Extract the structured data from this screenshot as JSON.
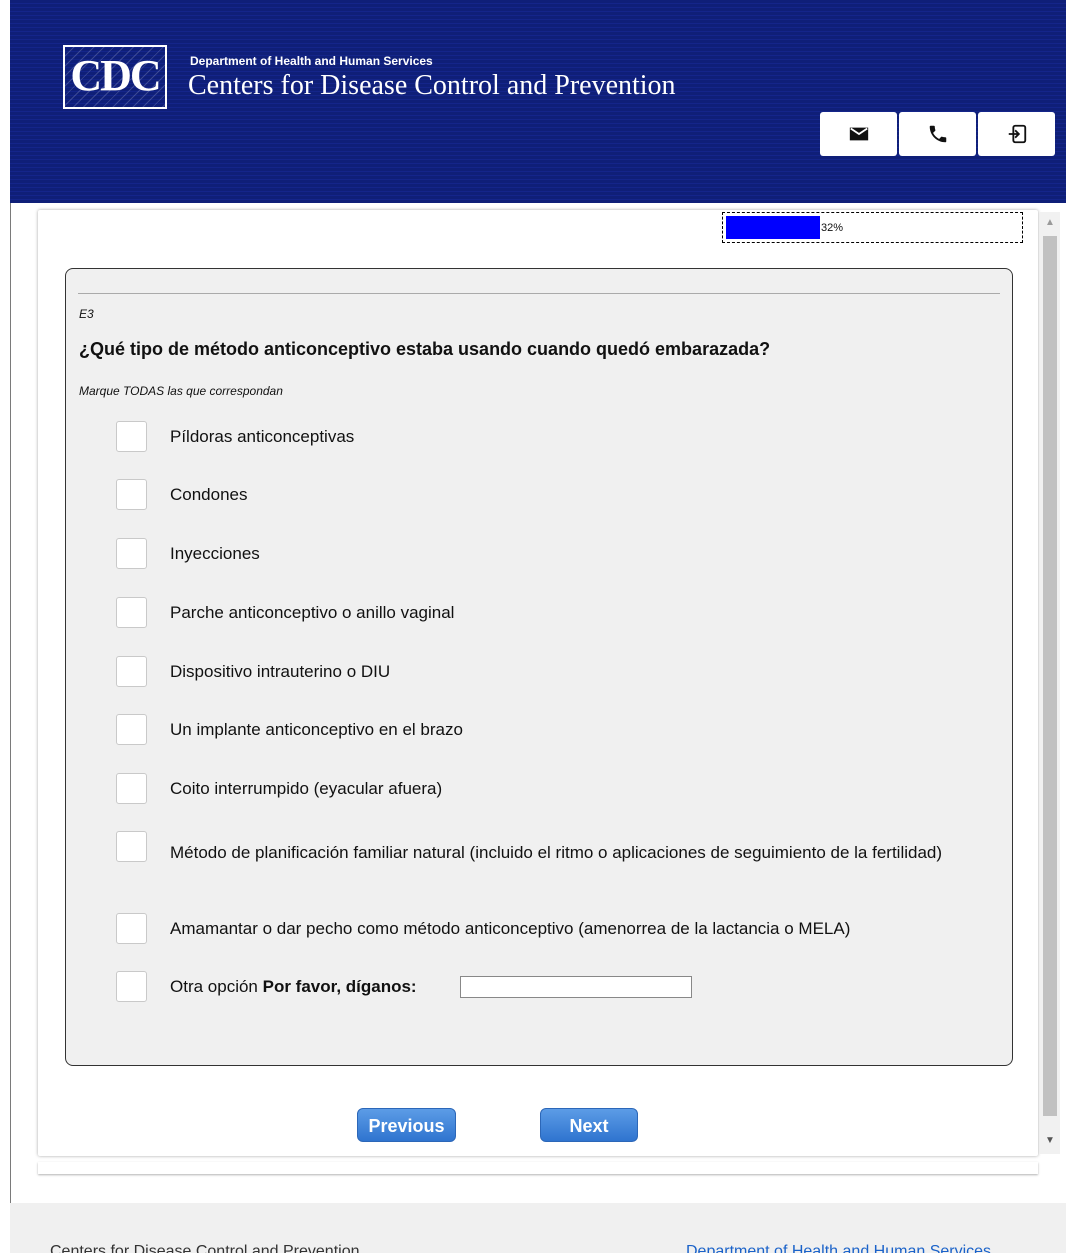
{
  "header": {
    "logo_text": "CDC",
    "department": "Department of Health and Human Services",
    "agency": "Centers for Disease Control and Prevention",
    "icons": [
      "mail-icon",
      "phone-icon",
      "exit-icon"
    ]
  },
  "progress": {
    "percent_label": "32%",
    "fraction": 0.32,
    "fill_color": "#0000ff"
  },
  "question": {
    "id": "E3",
    "text": "¿Qué tipo de método anticonceptivo estaba usando cuando quedó embarazada?",
    "instruction": "Marque TODAS las que correspondan",
    "options": [
      "Píldoras anticonceptivas",
      "Condones",
      "Inyecciones",
      "Parche anticonceptivo o anillo vaginal",
      "Dispositivo intrauterino o DIU",
      "Un implante anticonceptivo en el brazo",
      "Coito interrumpido (eyacular afuera)",
      "Método de planificación familiar natural (incluido el ritmo o aplicaciones de seguimiento de la fertilidad)",
      "Amamantar o dar pecho como método anticonceptivo (amenorrea de la lactancia o MELA)"
    ],
    "other": {
      "label": "Otra opción",
      "prompt": "Por favor, díganos:",
      "value": ""
    }
  },
  "nav": {
    "previous": "Previous",
    "next": "Next"
  },
  "footer": {
    "left": "Centers for Disease Control and Prevention",
    "right": "Department of Health and Human Services"
  },
  "colors": {
    "header_blue": "#0f1f78",
    "button_blue": "#2f74cf"
  }
}
